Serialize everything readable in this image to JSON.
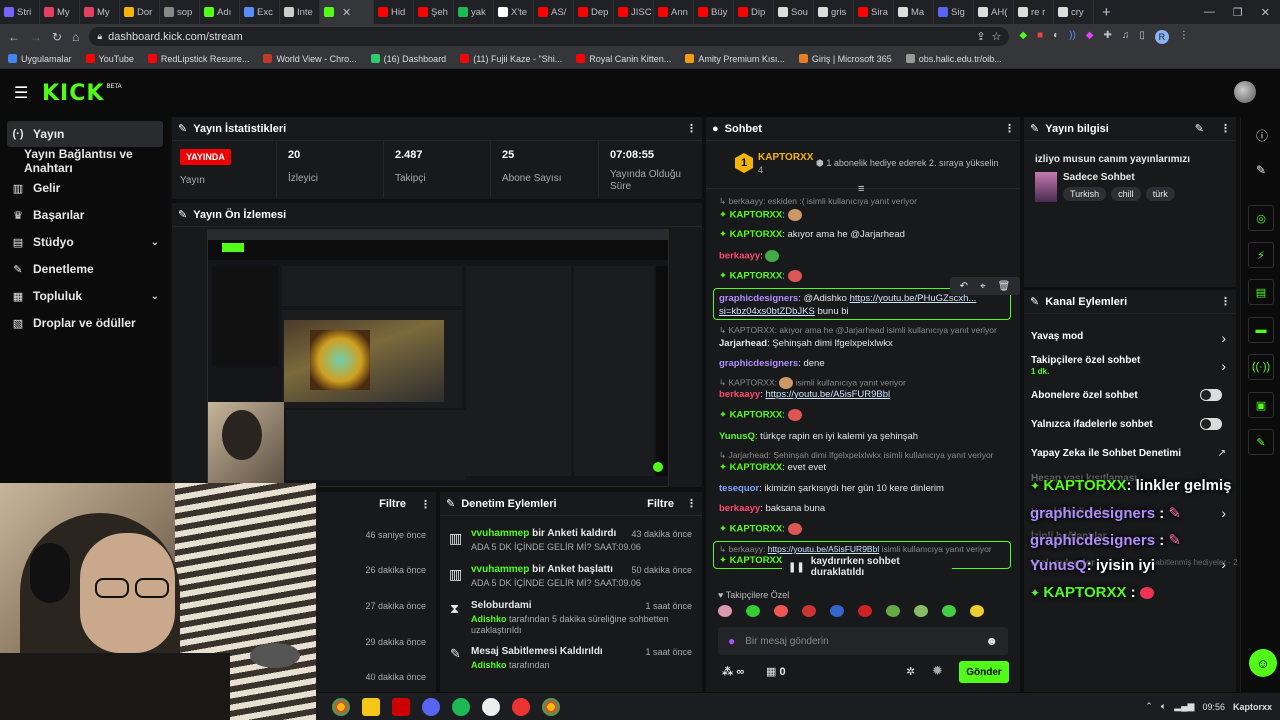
{
  "browser": {
    "tabs": [
      "Stri",
      "My",
      "My",
      "Dor",
      "sop",
      "Adı",
      "Exc",
      "Inte",
      "",
      "Hid",
      "Şeh",
      "yak",
      "X'te",
      "AS/",
      "Dep",
      "JISC",
      "Ann",
      "Büy",
      "Dip",
      "Sou",
      "gris",
      "Sira",
      "Ma",
      "Sig",
      "AH(",
      "re r",
      "cry"
    ],
    "url": "dashboard.kick.com/stream",
    "bookmarks": [
      "Uygulamalar",
      "YouTube",
      "RedLipstick Resurre...",
      "World View - Chro...",
      "(16) Dashboard",
      "(11) Fujii Kaze - \"Shi...",
      "Royal Canin Kitten...",
      "Amity Premium Kısı...",
      "Giriş | Microsoft 365",
      "obs.halic.edu.tr/oib..."
    ],
    "profile_initial": "R"
  },
  "header": {
    "logo": "KICK",
    "beta": "BETA"
  },
  "sidebar": {
    "items": [
      {
        "label": "Yayın"
      },
      {
        "label": "Yayın Bağlantısı ve Anahtarı"
      },
      {
        "label": "Gelir"
      },
      {
        "label": "Başarılar"
      },
      {
        "label": "Stüdyo"
      },
      {
        "label": "Denetleme"
      },
      {
        "label": "Topluluk"
      },
      {
        "label": "Droplar ve ödüller"
      }
    ]
  },
  "stats": {
    "title": "Yayın İstatistikleri",
    "live": "YAYINDA",
    "live_label": "Yayın",
    "viewers_value": "20",
    "viewers_label": "İzleyici",
    "followers_value": "2.487",
    "followers_label": "Takipçi",
    "subs_value": "25",
    "subs_label": "Abone Sayısı",
    "time_value": "07:08:55",
    "time_label": "Yayında Olduğu Süre"
  },
  "preview": {
    "title": "Yayın Ön İzlemesi"
  },
  "filter_panel": {
    "filter": "Filtre",
    "times": [
      "46 saniye önce",
      "26 dakika önce",
      "27 dakika önce",
      "29 dakika önce",
      "40 dakika önce"
    ]
  },
  "mod_actions": {
    "title": "Denetim Eylemleri",
    "filter": "Filtre",
    "entries": [
      {
        "user": "vvuhammep",
        "action": " bir Anketi kaldırdı",
        "time": "43 dakika önce",
        "detail": "ADA 5 DK İÇİNDE GELİR Mİ? SAAT:09.06"
      },
      {
        "user": "vvuhammep",
        "action": " bir Anket başlattı",
        "time": "50 dakika önce",
        "detail": "ADA 5 DK İÇİNDE GELİR Mİ? SAAT:09.06"
      },
      {
        "user": "Seloburdami",
        "action": "",
        "time": "1 saat önce",
        "detail_user": "Adishko",
        "detail": " tarafından 5 dakika süreliğine sohbetten uzaklaştırıldı"
      },
      {
        "user": "Mesaj Sabitlemesi Kaldırıldı",
        "action": "",
        "time": "1 saat önce",
        "detail_user": "Adishko",
        "detail": " tarafından"
      }
    ]
  },
  "chat": {
    "title": "Sohbet",
    "gift_user": "KAPTORXX",
    "gift_count": "4",
    "gift_rank": "1",
    "gift_text": "1 abonelik hediye ederek 2. sıraya yükselin",
    "lines": [
      {
        "reply": "berkaayy: eskiden :( isimli kullanıcıya yanıt veriyor"
      },
      {
        "user": "KAPTORXX",
        "text": ""
      },
      {
        "user": "KAPTORXX",
        "text": " akıyor ama he @Jarjarhead"
      },
      {
        "user": "berkaayy",
        "text": ""
      },
      {
        "user": "KAPTORXX",
        "text": ""
      },
      {
        "user": "graphicdesigners",
        "text": " @Adishko ",
        "link": "https://youtu.be/PHuGZscxh...",
        "link2": "si=kbz04xs0btZDbJKS",
        "after": " bunu bi"
      },
      {
        "reply": "KAPTORXX: akıyor ama he @Jarjarhead isimli kullanıcıya yanıt veriyor"
      },
      {
        "user": "Jarjarhead",
        "text": " Şehinşah dimi lfgelxpelxlwkx"
      },
      {
        "user": "graphicdesigners",
        "text": " dene"
      },
      {
        "reply": "KAPTORXX:",
        "reply2": " isimli kullanıcıya yanıt veriyor"
      },
      {
        "user": "berkaayy",
        "text": " ",
        "link": "https://youtu.be/A5isFUR9Bbl"
      },
      {
        "user": "KAPTORXX",
        "text": ""
      },
      {
        "user": "YunusQ",
        "text": " türkçe rapin en iyi kalemi ya şehinşah"
      },
      {
        "reply": "Jarjarhead: Şehinşah dimi lfgelxpelxlwkx isimli kullanıcıya yanıt veriyor"
      },
      {
        "user": "KAPTORXX",
        "text": " evet evet"
      },
      {
        "user": "tesequor",
        "text": " ikimizin şarkısıydı her gün 10 kere dinlerim"
      },
      {
        "user": "berkaayy",
        "text": " baksana buna"
      },
      {
        "user": "KAPTORXX",
        "text": ""
      },
      {
        "reply": "berkaayy: ",
        "link": "https://youtu.be/A5isFUR9Bbl",
        "reply2": " isimli kullanıcıya yanıt veriyor"
      },
      {
        "user": "KAPTORXX",
        "text": ""
      }
    ],
    "paused": "kaydırırken sohbet duraklatıldı",
    "followers_only": "Takipçilere Özel",
    "placeholder": "Bir mesaj gönderin",
    "infinity": "∞",
    "count": "0",
    "send": "Gönder"
  },
  "stream_info": {
    "title": "Yayın bilgisi",
    "stream_title": "izliyo musun canım yayınlarımızı",
    "category": "Sadece Sohbet",
    "tags": [
      "Turkish",
      "chill",
      "türk"
    ]
  },
  "channel_actions": {
    "title": "Kanal Eylemleri",
    "slow": "Yavaş mod",
    "followers": "Takipçilere özel sohbet",
    "followers_sub": "1 dk.",
    "subs": "Abonelere özel sohbet",
    "emotes": "Yalnızca ifadelerle sohbet",
    "ai": "Yapay Zeka ile Sohbet Denetimi",
    "partial1": "Hesap yaşı kısıtlaması",
    "partial2": "Yasaklı kelimeler",
    "partial3": "İzinli bağlantılar",
    "partial4": "Hızlı eylemler",
    "partial5": "Sabitlenmiş hediyeler - 2"
  },
  "overlay": {
    "l1_user": "KAPTORXX",
    "l1_text": ": linkler gelmiş",
    "l2_user": "graphicdesigners",
    "l2_text": ":",
    "l3_user": "graphicdesigners",
    "l3_text": ":",
    "l4_user": "YunusQ",
    "l4_text": ": iyisin iyi",
    "l5_user": "KAPTORXX",
    "l5_text": ":"
  },
  "taskbar": {
    "time": "09:56",
    "watermark": "Kaptorxx"
  },
  "colors": {
    "accent": "#53fc18",
    "live": "#ee0000",
    "purple": "#b18cff",
    "red": "#ff4a6e"
  }
}
